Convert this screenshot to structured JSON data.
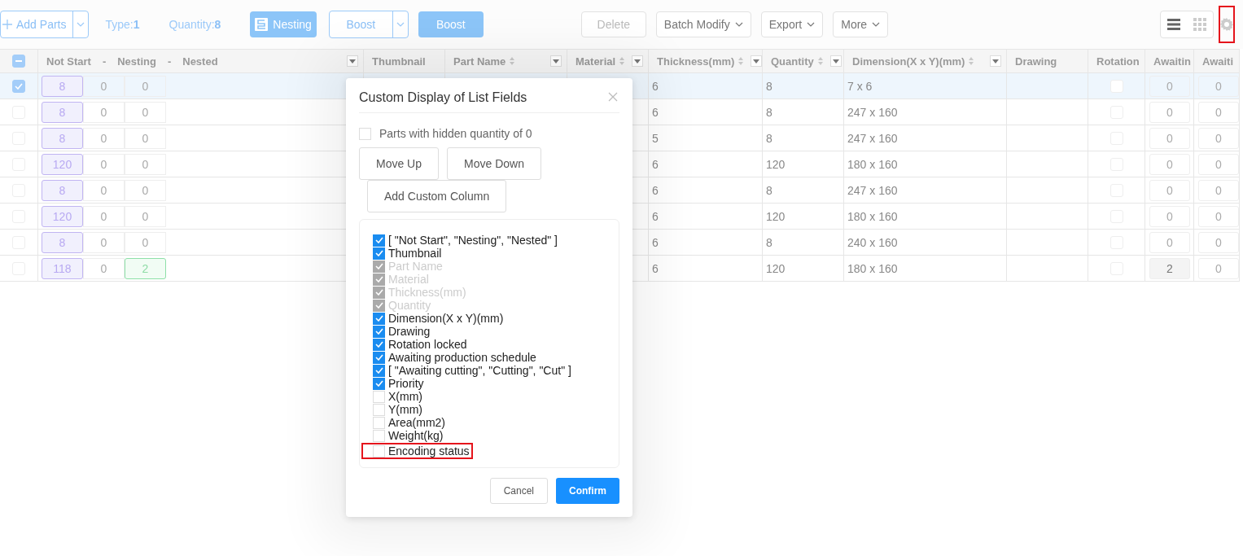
{
  "toolbar": {
    "add_parts": "Add Parts",
    "type": "Type:**1**",
    "quantity": "Quantity:**8**",
    "nesting": "Nesting",
    "boost_split": "Boost",
    "boost": "Boost",
    "delete": "Delete",
    "batch_modify": "Batch Modify",
    "export": "Export",
    "more": "More",
    "view_mode": [
      {
        "kind": "list",
        "selected": true
      },
      {
        "kind": "grid",
        "selected": false
      }
    ],
    "settings_highlighted": true
  },
  "table": {
    "select_all_partial": true,
    "status_header": [
      "Not Start",
      "-",
      "Nesting",
      "-",
      "Nested"
    ],
    "columns": [
      {
        "label": "Thumbnail",
        "sort": false,
        "filter": false
      },
      {
        "label": "Part Name",
        "sort": true,
        "filter": true
      },
      {
        "label": "Material",
        "sort": true,
        "filter": true
      },
      {
        "label": "Thickness(mm)",
        "sort": true,
        "filter": true
      },
      {
        "label": "Quantity",
        "sort": true,
        "filter": true
      },
      {
        "label": "Dimension(X x Y)(mm)",
        "sort": true,
        "filter": true
      },
      {
        "label": "Drawing",
        "sort": false,
        "filter": false
      },
      {
        "label": "Rotation"
      },
      {
        "label": "Awaitin"
      },
      {
        "label": "Awaiti"
      }
    ],
    "rows": [
      {
        "selected": true,
        "status": [
          {
            "value": "8",
            "kind": "pending"
          },
          {
            "value": "0",
            "kind": "idle"
          },
          {
            "value": "0",
            "kind": "idle"
          }
        ],
        "thickness": "6",
        "quantity": "8",
        "dimension": "7 x 6",
        "rotation_locked": false,
        "awaiting": [
          {
            "value": "0",
            "active": false
          },
          {
            "value": "0",
            "active": false
          }
        ]
      },
      {
        "selected": false,
        "status": [
          {
            "value": "8",
            "kind": "pending"
          },
          {
            "value": "0",
            "kind": "idle"
          },
          {
            "value": "0",
            "kind": "idle"
          }
        ],
        "thickness": "6",
        "quantity": "8",
        "dimension": "247 x 160",
        "rotation_locked": false,
        "awaiting": [
          {
            "value": "0",
            "active": false
          },
          {
            "value": "0",
            "active": false
          }
        ]
      },
      {
        "selected": false,
        "status": [
          {
            "value": "8",
            "kind": "pending"
          },
          {
            "value": "0",
            "kind": "idle"
          },
          {
            "value": "0",
            "kind": "idle"
          }
        ],
        "thickness": "5",
        "quantity": "8",
        "dimension": "247 x 160",
        "rotation_locked": false,
        "awaiting": [
          {
            "value": "0",
            "active": false
          },
          {
            "value": "0",
            "active": false
          }
        ]
      },
      {
        "selected": false,
        "status": [
          {
            "value": "120",
            "kind": "pending"
          },
          {
            "value": "0",
            "kind": "idle"
          },
          {
            "value": "0",
            "kind": "idle"
          }
        ],
        "thickness": "6",
        "quantity": "120",
        "dimension": "180 x 160",
        "rotation_locked": false,
        "awaiting": [
          {
            "value": "0",
            "active": false
          },
          {
            "value": "0",
            "active": false
          }
        ]
      },
      {
        "selected": false,
        "status": [
          {
            "value": "8",
            "kind": "pending"
          },
          {
            "value": "0",
            "kind": "idle"
          },
          {
            "value": "0",
            "kind": "idle"
          }
        ],
        "thickness": "6",
        "quantity": "8",
        "dimension": "247 x 160",
        "rotation_locked": false,
        "awaiting": [
          {
            "value": "0",
            "active": false
          },
          {
            "value": "0",
            "active": false
          }
        ]
      },
      {
        "selected": false,
        "status": [
          {
            "value": "120",
            "kind": "pending"
          },
          {
            "value": "0",
            "kind": "idle"
          },
          {
            "value": "0",
            "kind": "idle"
          }
        ],
        "thickness": "6",
        "quantity": "120",
        "dimension": "180 x 160",
        "rotation_locked": false,
        "awaiting": [
          {
            "value": "0",
            "active": false
          },
          {
            "value": "0",
            "active": false
          }
        ]
      },
      {
        "selected": false,
        "status": [
          {
            "value": "8",
            "kind": "pending"
          },
          {
            "value": "0",
            "kind": "idle"
          },
          {
            "value": "0",
            "kind": "idle"
          }
        ],
        "thickness": "6",
        "quantity": "8",
        "dimension": "240 x 160",
        "rotation_locked": false,
        "awaiting": [
          {
            "value": "0",
            "active": false
          },
          {
            "value": "0",
            "active": false
          }
        ]
      },
      {
        "selected": false,
        "status": [
          {
            "value": "118",
            "kind": "pending"
          },
          {
            "value": "0",
            "kind": "idle"
          },
          {
            "value": "2",
            "kind": "done"
          }
        ],
        "thickness": "6",
        "quantity": "120",
        "dimension": "180 x 160",
        "rotation_locked": false,
        "awaiting": [
          {
            "value": "2",
            "active": true
          },
          {
            "value": "0",
            "active": false
          }
        ]
      }
    ]
  },
  "dialog": {
    "title": "Custom Display of List Fields",
    "hide_zero": {
      "label": "Parts with hidden quantity of 0",
      "checked": false
    },
    "buttons": [
      "Move Up",
      "Move Down",
      "Add Custom Column"
    ],
    "fields": [
      {
        "label": "[ \"Not Start\", \"Nesting\", \"Nested\" ]",
        "checked": true,
        "disabled": false,
        "highlighted": false
      },
      {
        "label": "Thumbnail",
        "checked": true,
        "disabled": false,
        "highlighted": false
      },
      {
        "label": "Part Name",
        "checked": true,
        "disabled": true,
        "highlighted": false
      },
      {
        "label": "Material",
        "checked": true,
        "disabled": true,
        "highlighted": false
      },
      {
        "label": "Thickness(mm)",
        "checked": true,
        "disabled": true,
        "highlighted": false
      },
      {
        "label": "Quantity",
        "checked": true,
        "disabled": true,
        "highlighted": false
      },
      {
        "label": "Dimension(X x Y)(mm)",
        "checked": true,
        "disabled": false,
        "highlighted": false
      },
      {
        "label": "Drawing",
        "checked": true,
        "disabled": false,
        "highlighted": false
      },
      {
        "label": "Rotation locked",
        "checked": true,
        "disabled": false,
        "highlighted": false
      },
      {
        "label": "Awaiting production schedule",
        "checked": true,
        "disabled": false,
        "highlighted": false
      },
      {
        "label": "[ \"Awaiting cutting\", \"Cutting\", \"Cut\" ]",
        "checked": true,
        "disabled": false,
        "highlighted": false
      },
      {
        "label": "Priority",
        "checked": true,
        "disabled": false,
        "highlighted": false
      },
      {
        "label": "X(mm)",
        "checked": false,
        "disabled": false,
        "highlighted": false
      },
      {
        "label": "Y(mm)",
        "checked": false,
        "disabled": false,
        "highlighted": false
      },
      {
        "label": "Area(mm2)",
        "checked": false,
        "disabled": false,
        "highlighted": false
      },
      {
        "label": "Weight(kg)",
        "checked": false,
        "disabled": false,
        "highlighted": false
      },
      {
        "label": "Encoding status",
        "checked": false,
        "disabled": false,
        "highlighted": true
      }
    ],
    "cancel": "Cancel",
    "confirm": "Confirm"
  }
}
